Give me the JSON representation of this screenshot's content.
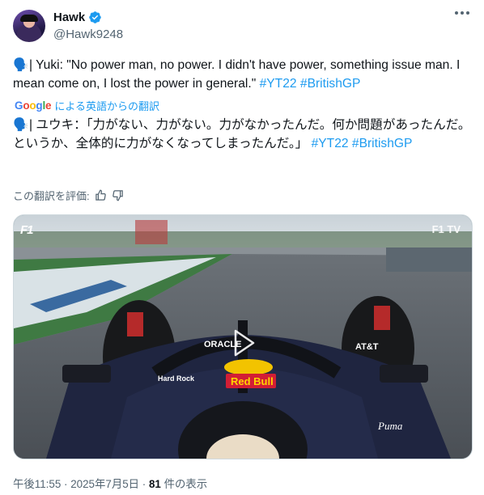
{
  "author": {
    "name": "Hawk",
    "handle": "@Hawk9248"
  },
  "tweet": {
    "emoji": "🗣️",
    "en_text": "| Yuki: \"No power man, no power. I didn't have power, something issue man. I mean come on, I lost the power in general.\" ",
    "en_tags": [
      "#YT22",
      "#BritishGP"
    ],
    "translate_brand": "Google",
    "translate_label": "による英語からの翻訳",
    "ja_text": "| ユウキ：「力がない、力がない。力がなかったんだ。何か問題があったんだ。というか、全体的に力がなくなってしまったんだ。」 ",
    "ja_tags": [
      "#YT22",
      "#BritishGP"
    ],
    "rate_label": "この翻訳を評価:"
  },
  "video": {
    "logo": "F1",
    "tv_label": "F1 TV",
    "car_texts": [
      "ORACLE",
      "Red Bull",
      "AT&T",
      "Puma",
      "Hard Rock"
    ]
  },
  "meta": {
    "time": "午後11:55",
    "separator": " · ",
    "date": "2025年7月5日",
    "views_count": "81",
    "views_label": " 件の表示"
  },
  "colors": {
    "link": "#1d9bf0",
    "secondary": "#536471",
    "text": "#0f1419"
  }
}
